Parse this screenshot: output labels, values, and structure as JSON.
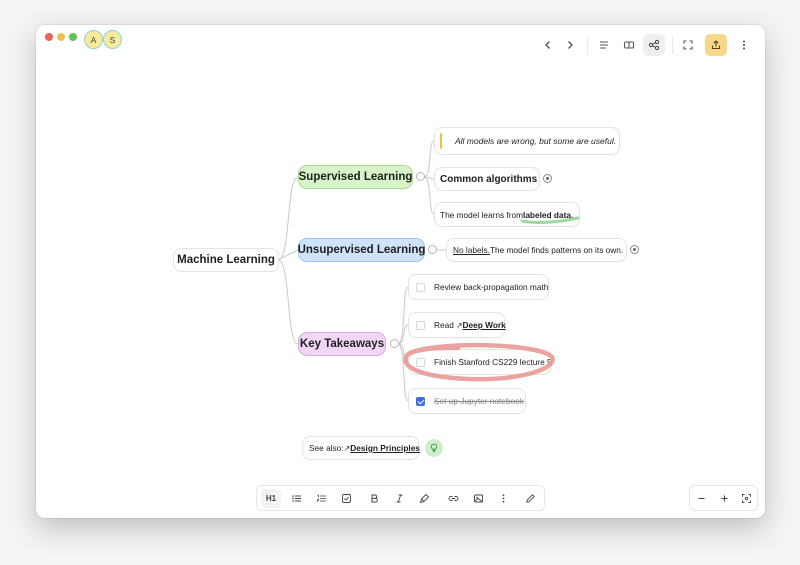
{
  "window": {
    "avatars": [
      "A",
      "S"
    ]
  },
  "toolbar": {
    "icons": [
      "chevron-left-icon",
      "chevron-right-icon",
      "align-left-icon",
      "split-view-icon",
      "share-graph-icon",
      "fullscreen-icon",
      "export-icon",
      "more-vertical-icon"
    ],
    "accent_color": "#f6d88a"
  },
  "mindmap": {
    "root": "Machine Learning",
    "branches": [
      {
        "label": "Supervised Learning",
        "color": "#d7f3c8",
        "border": "#a9d98f"
      },
      {
        "label": "Unsupervised Learning",
        "color": "#cfe3fb",
        "border": "#9ec3ef"
      },
      {
        "label": "Key Takeaways",
        "color": "#f1d6f7",
        "border": "#d7a9e4"
      }
    ],
    "supervised": {
      "quote": "All models are wrong, but some are useful.",
      "algorithms": "Common algorithms",
      "desc_prefix": "The model learns from ",
      "desc_highlight": "labeled data."
    },
    "unsupervised": {
      "desc_underlined": "No labels.",
      "desc_rest": " The model finds patterns on its own."
    },
    "takeaways": {
      "items": [
        {
          "text": "Review back-propagation math",
          "checked": false
        },
        {
          "prefix": "Read ",
          "link": "Deep Work",
          "checked": false
        },
        {
          "text": "Finish Stanford CS229 lecture 5",
          "checked": false
        },
        {
          "text": "Set up Jupyter notebook",
          "checked": true
        }
      ]
    },
    "see_also": {
      "prefix": "See also: ",
      "link": "Design Principles"
    }
  },
  "bottom_toolbar": {
    "heading_label": "H1",
    "icons": [
      "heading-icon",
      "bullet-list-icon",
      "numbered-list-icon",
      "checkbox-icon",
      "bold-icon",
      "italic-icon",
      "highlight-icon",
      "link-icon",
      "image-icon",
      "more-vertical-icon",
      "pen-icon"
    ]
  },
  "zoom_toolbar": {
    "icons": [
      "zoom-out-icon",
      "zoom-in-icon",
      "fit-screen-icon"
    ]
  }
}
